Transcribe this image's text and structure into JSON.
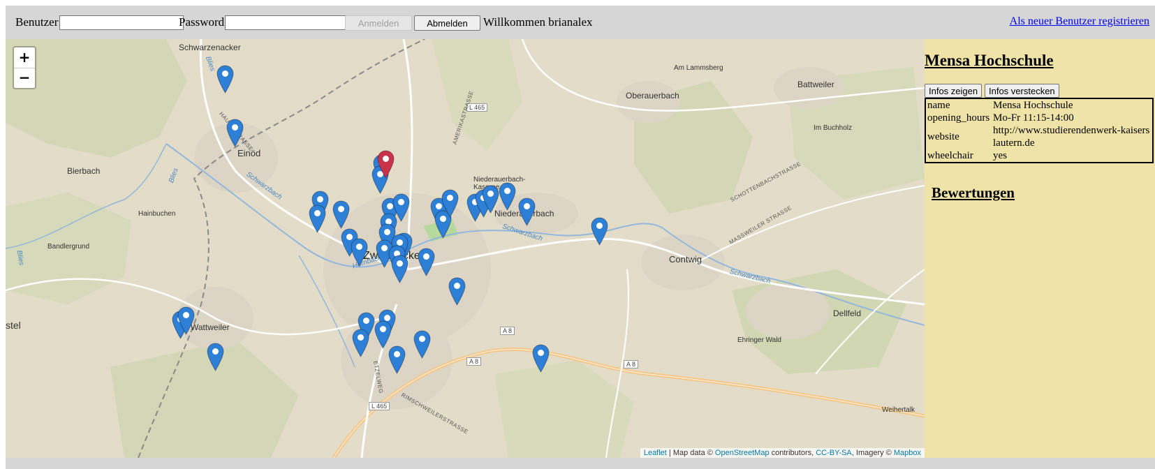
{
  "header": {
    "username_label": "Benutzer:",
    "username_value": "",
    "password_label": "Password:",
    "password_value": "",
    "login_button": "Anmelden",
    "logout_button": "Abmelden",
    "welcome_text": "Willkommen brianalex",
    "register_link": "Als neuer Benutzer registrieren"
  },
  "map": {
    "zoom_in": "+",
    "zoom_out": "−",
    "places": [
      "Schwarzenacker",
      "Einöd",
      "Bierbach",
      "Hainbuchen",
      "Bandlergrund",
      "stel",
      "Wattweiler",
      "Zweibrücken",
      "Niederauerbach-Kaserne",
      "Niederauerbach",
      "Am Lammsberg",
      "Oberauerbach",
      "Battweiler",
      "Im Buchholz",
      "Contwig",
      "Dellfeld",
      "Ehringer Wald",
      "Weihertalk"
    ],
    "roads": [
      "L 465",
      "A 8",
      "A 8",
      "A 8",
      "L 465"
    ],
    "waters": [
      "Schwarzbach",
      "Schwarzbach",
      "Schwarzbach",
      "Hornbach",
      "Blies",
      "Blies",
      "Blies"
    ],
    "streets": [
      "HAUPTSTRASSE",
      "AMERIKASTRASSE",
      "SCHOTTENBACHSTRASSE",
      "MASSWEILER STRASSE",
      "ETZELWEG",
      "RIMSCHWEILERSTRASSE"
    ],
    "selected_marker_color": "#c9334a",
    "marker_color": "#2e7fd6",
    "attribution": {
      "leaflet": "Leaflet",
      "map_data": " | Map data © ",
      "osm": "OpenStreetMap",
      "contributors": " contributors, ",
      "license": "CC-BY-SA",
      "imagery": ", Imagery © ",
      "mapbox": "Mapbox"
    }
  },
  "sidebar": {
    "title": "Mensa Hochschule",
    "show_info_button": "Infos zeigen",
    "hide_info_button": "Infos verstecken",
    "info": [
      {
        "key": "name",
        "value": "Mensa Hochschule"
      },
      {
        "key": "opening_hours",
        "value": "Mo-Fr 11:15-14:00"
      },
      {
        "key": "website",
        "value": "http://www.studierendenwerk-kaiserslautern.de"
      },
      {
        "key": "wheelchair",
        "value": "yes"
      }
    ],
    "reviews_title": "Bewertungen"
  }
}
